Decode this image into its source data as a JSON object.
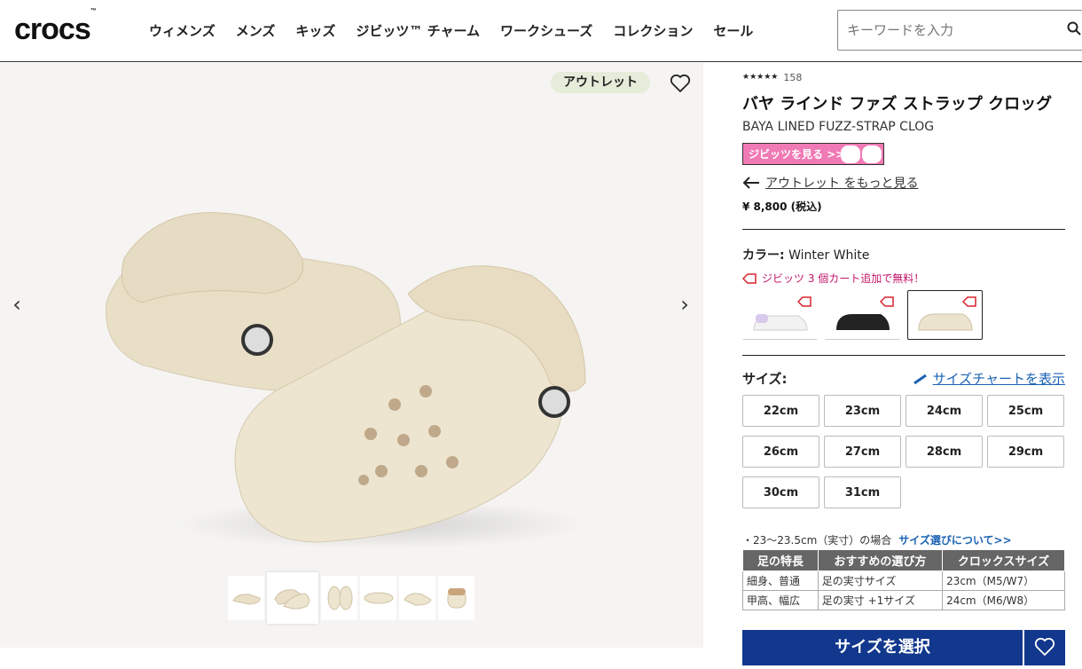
{
  "header": {
    "logo": "crocs",
    "logo_tm": "™",
    "nav": [
      "ウィメンズ",
      "メンズ",
      "キッズ",
      "ジビッツ™ チャーム",
      "ワークシューズ",
      "コレクション",
      "セール"
    ],
    "search_placeholder": "キーワードを入力"
  },
  "gallery": {
    "badge": "アウトレット",
    "prev_arrow": "‹",
    "next_arrow": "›",
    "thumbnail_count": 6,
    "active_thumbnail": 2
  },
  "product": {
    "rating_count": "158",
    "rating_value": 4.5,
    "name_jp": "バヤ ラインド ファズ ストラップ クロッグ",
    "name_en": "BAYA LINED FUZZ-STRAP CLOG",
    "jibbitz_banner": "ジビッツを見る >>",
    "outlet_link": "アウトレット をもっと見る",
    "price": "¥ 8,800 (税込)",
    "color_label": "カラー:",
    "color_value": "Winter White",
    "promo": "ジビッツ 3 個カート追加で無料！",
    "swatches": [
      {
        "name": "white-lavender",
        "color": "#d9c9ec"
      },
      {
        "name": "black",
        "color": "#222222"
      },
      {
        "name": "winter-white",
        "color": "#ece3cf"
      }
    ],
    "selected_swatch": 2,
    "size_label": "サイズ:",
    "size_chart_link": "サイズチャートを表示",
    "sizes": [
      "22cm",
      "23cm",
      "24cm",
      "25cm",
      "26cm",
      "27cm",
      "28cm",
      "29cm",
      "30cm",
      "31cm"
    ],
    "size_note": "・23〜23.5cm（実寸）の場合",
    "size_note_link": "サイズ選びについて>>",
    "size_table": {
      "headers": [
        "足の特長",
        "おすすめの選び方",
        "クロックスサイズ"
      ],
      "rows": [
        [
          "細身、普通",
          "足の実寸サイズ",
          "23cm（M5/W7）"
        ],
        [
          "甲高、幅広",
          "足の実寸 +1サイズ",
          "24cm（M6/W8）"
        ]
      ]
    },
    "add_button": "サイズを選択"
  },
  "colors": {
    "brand_blue": "#12388d",
    "link_blue": "#1a62b3",
    "promo_pink": "#c4166a",
    "banner_pink": "#f07ab5",
    "badge_green": "#e5ecd9"
  }
}
